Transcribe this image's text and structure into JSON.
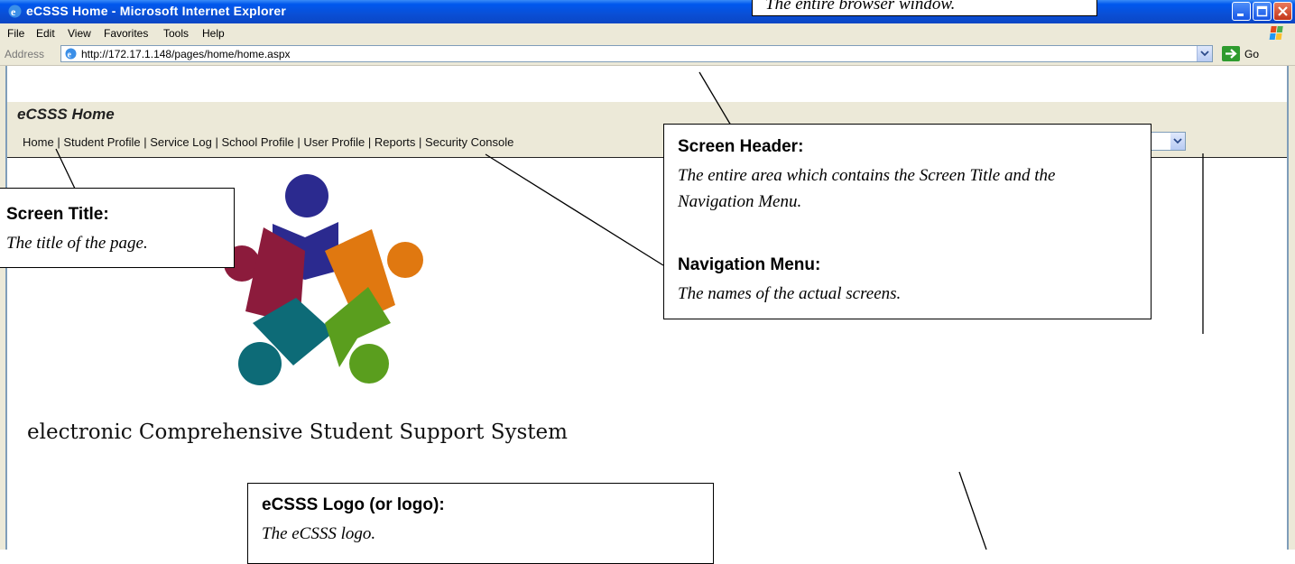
{
  "window": {
    "title": "eCSSS Home - Microsoft Internet Explorer"
  },
  "menu": [
    "File",
    "Edit",
    "View",
    "Favorites",
    "Tools",
    "Help"
  ],
  "address": {
    "label": "Address",
    "url": "http://172.17.1.148/pages/home/home.aspx",
    "go_label": "Go"
  },
  "page": {
    "screen_title": "eCSSS Home",
    "nav_items": [
      "Home",
      "Student Profile",
      "Service Log",
      "School Profile",
      "User Profile",
      "Reports",
      "Security Console"
    ],
    "tagline": "electronic Comprehensive Student Support System"
  },
  "callouts": {
    "browser": {
      "text": "The entire browser window."
    },
    "screen_header": {
      "heading": "Screen Header:",
      "desc": "The entire area which contains the Screen Title and the Navigation Menu."
    },
    "navigation_menu": {
      "heading": "Navigation Menu:",
      "desc": "The names of the actual screens."
    },
    "screen_title": {
      "heading": "Screen Title:",
      "desc": "The title of the page."
    },
    "logo": {
      "heading": "eCSSS Logo (or logo):",
      "desc": "The eCSSS logo."
    }
  },
  "icons": {
    "ie": "internet-explorer-icon",
    "windows": "windows-flag-icon",
    "go": "go-arrow-icon"
  },
  "colors": {
    "titlebar": "#0a4fd6",
    "logo_blue": "#2b2a8f",
    "logo_orange": "#e07810",
    "logo_maroon": "#8c1b3c",
    "logo_teal": "#0d6b77",
    "logo_green": "#5a9e1e"
  }
}
